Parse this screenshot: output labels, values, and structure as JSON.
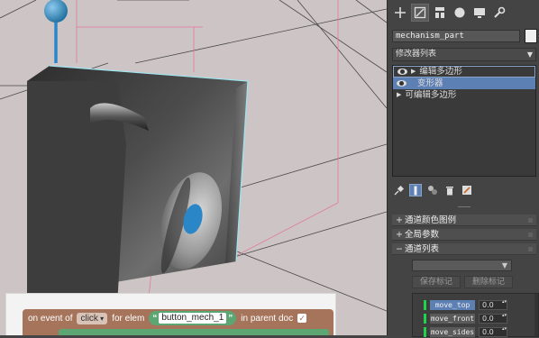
{
  "viewport": {
    "label": "3D viewport"
  },
  "blockly": {
    "event_prefix": "on event of",
    "event_type": "click",
    "for_elem": "for elem",
    "quote_open": "“",
    "element_id": "button_mech_1",
    "quote_close": "”",
    "in_parent_doc": "in parent doc",
    "checked": "✓",
    "block_color": "#a5745b",
    "string_color": "#5ba672"
  },
  "panel": {
    "tabs": [
      {
        "icon": "create-plus-icon",
        "active": false
      },
      {
        "icon": "modify-icon",
        "active": true
      },
      {
        "icon": "hierarchy-icon",
        "active": false
      },
      {
        "icon": "motion-icon",
        "active": false
      },
      {
        "icon": "display-icon",
        "active": false
      },
      {
        "icon": "utilities-wrench-icon",
        "active": false
      }
    ],
    "object_name": "mechanism_part",
    "object_color": "#f0f0f0",
    "modifier_list_label": "修改器列表",
    "stack": [
      {
        "label": "编辑多边形",
        "eye": true,
        "expand": "▶",
        "state": "outlined"
      },
      {
        "label": "变形器",
        "eye": true,
        "expand": "",
        "state": "selected"
      },
      {
        "label": "可编辑多边形",
        "eye": false,
        "expand": "▶",
        "state": "normal"
      }
    ],
    "rollouts": {
      "channel_color_legend": {
        "sign": "+",
        "label": "通道颜色图例"
      },
      "global_params": {
        "sign": "+",
        "label": "全局参数"
      },
      "channel_list": {
        "sign": "−",
        "label": "通道列表"
      }
    },
    "buttons": {
      "save_marker": "保存标记",
      "delete_marker": "删除标记"
    },
    "channels": [
      {
        "name": "move_top",
        "value": "0.0",
        "selected": true
      },
      {
        "name": "move_front",
        "value": "0.0",
        "selected": false
      },
      {
        "name": "move_sides",
        "value": "0.0",
        "selected": false
      }
    ],
    "accent": "#5c7fb4",
    "channel_marker_color": "#1fd34a"
  }
}
